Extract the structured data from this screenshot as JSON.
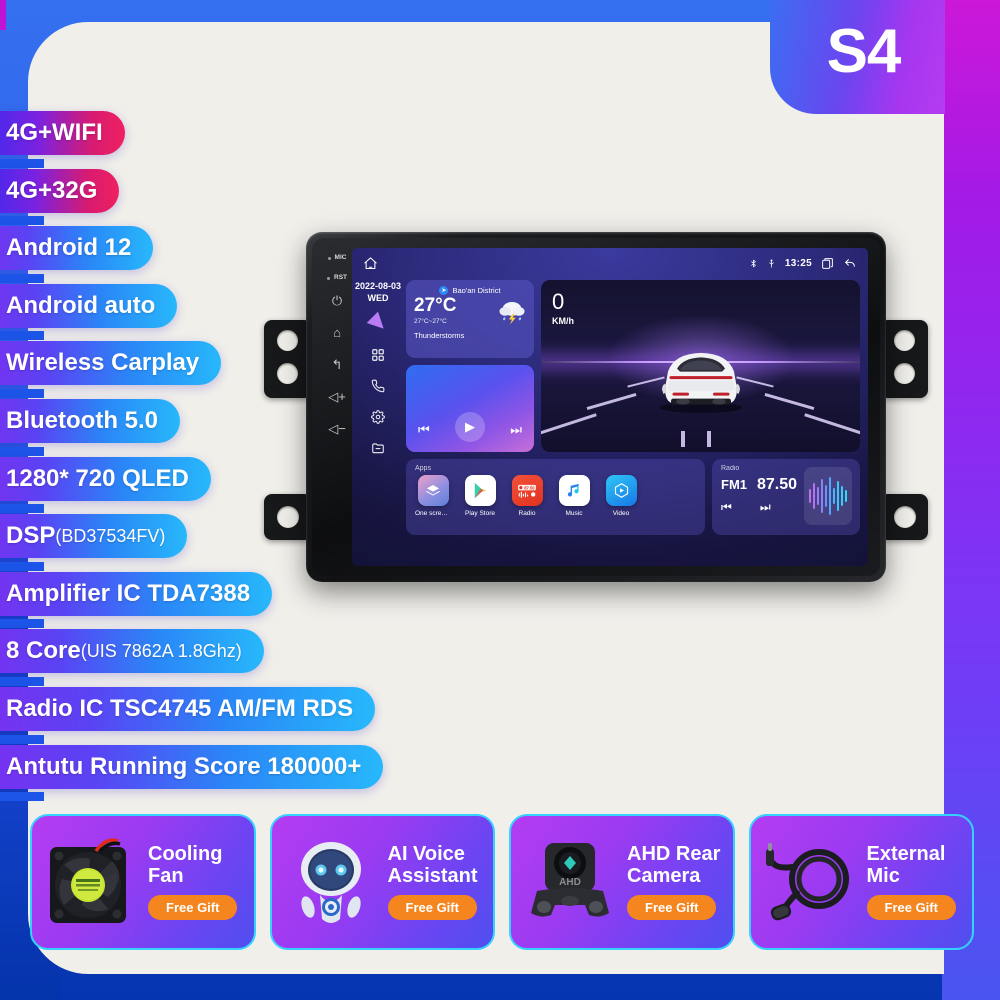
{
  "badge": {
    "model": "S4"
  },
  "specs": [
    {
      "text": "4G+WIFI",
      "style": "red"
    },
    {
      "text": "4G+32G",
      "style": "red"
    },
    {
      "text": "Android 12",
      "style": "blue"
    },
    {
      "text": "Android auto",
      "style": "blue"
    },
    {
      "text": "Wireless Carplay",
      "style": "blue"
    },
    {
      "text": "Bluetooth 5.0",
      "style": "blue"
    },
    {
      "text": "1280* 720 QLED",
      "style": "blue"
    },
    {
      "text": "DSP",
      "sub": "(BD37534FV)",
      "style": "blue"
    },
    {
      "text": "Amplifier IC TDA7388",
      "style": "blue"
    },
    {
      "text": "8 Core",
      "sub": "(UIS 7862A 1.8Ghz)",
      "style": "blue"
    },
    {
      "text": "Radio IC TSC4745 AM/FM RDS",
      "style": "blue"
    },
    {
      "text": "Antutu Running Score 180000+",
      "style": "blue"
    }
  ],
  "device": {
    "bezel_labels": [
      "MIC",
      "RST"
    ],
    "bezel_icons": [
      "power-icon",
      "home-icon",
      "back-icon",
      "volume-up-icon",
      "volume-down-icon"
    ],
    "statusbar": {
      "home": "home-icon",
      "bluetooth": "bluetooth-icon",
      "usb": "usb-icon",
      "time": "13:25",
      "recents": "recents-icon",
      "back": "back-icon"
    },
    "sidebar": {
      "date": "2022-08-03",
      "day": "WED",
      "icons": [
        "navigation-icon",
        "apps-grid-icon",
        "phone-icon",
        "settings-icon",
        "files-icon"
      ]
    },
    "weather": {
      "location": "Bao'an District",
      "temp": "27°C",
      "range": "27°C~27°C",
      "condition": "Thunderstorms",
      "icon": "thunderstorm-icon"
    },
    "media": {
      "prev": "skip-previous-icon",
      "play": "play-icon",
      "next": "skip-next-icon"
    },
    "drive": {
      "speed": "0",
      "unit": "KM/h"
    },
    "apps": {
      "label": "Apps",
      "items": [
        {
          "name": "One screen in..",
          "icon": "layers-icon"
        },
        {
          "name": "Play Store",
          "icon": "play-store-icon"
        },
        {
          "name": "Radio",
          "icon": "radio-icon"
        },
        {
          "name": "Music",
          "icon": "music-note-icon"
        },
        {
          "name": "Video",
          "icon": "video-icon"
        }
      ]
    },
    "radio": {
      "label": "Radio",
      "band": "FM1",
      "frequency": "87.50",
      "prev": "skip-previous-icon",
      "next": "skip-next-icon"
    }
  },
  "gifts": [
    {
      "title": "Cooling\nFan",
      "badge": "Free Gift",
      "art": "cooling-fan-image"
    },
    {
      "title": "AI Voice\nAssistant",
      "badge": "Free Gift",
      "art": "ai-robot-image"
    },
    {
      "title": "AHD Rear\nCamera",
      "badge": "Free Gift",
      "art": "rear-camera-image"
    },
    {
      "title": "External\nMic",
      "badge": "Free Gift",
      "art": "external-mic-image"
    }
  ],
  "colors": {
    "accent_blue": "#1c55e8",
    "gift_orange": "#f5861f",
    "badge_gradient_start": "#3c6df2",
    "badge_gradient_end": "#b43cf0"
  }
}
